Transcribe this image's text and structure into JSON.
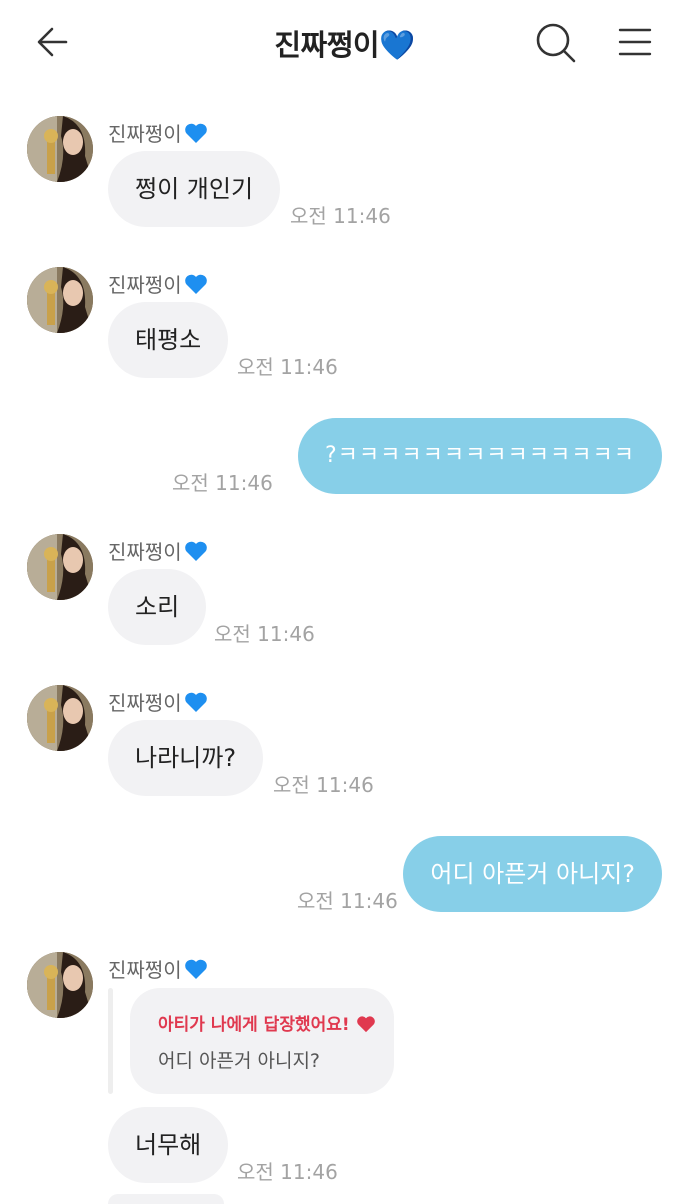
{
  "header": {
    "title": "진짜쩡이💙"
  },
  "messages": [
    {
      "sender": "진짜쩡이",
      "text": "쩡이 개인기",
      "time": "오전 11:46"
    },
    {
      "sender": "진짜쩡이",
      "text": "태평소",
      "time": "오전 11:46"
    },
    {
      "text": "?ㅋㅋㅋㅋㅋㅋㅋㅋㅋㅋㅋㅋㅋㅋ",
      "time": "오전 11:46"
    },
    {
      "sender": "진짜쩡이",
      "text": "소리",
      "time": "오전 11:46"
    },
    {
      "sender": "진짜쩡이",
      "text": "나라니까?",
      "time": "오전 11:46"
    },
    {
      "text": "어디 아픈거 아니지?",
      "time": "오전 11:46"
    },
    {
      "sender": "진짜쩡이",
      "reply_header": "아티가 나에게 답장했어요!",
      "reply_quote": "어디 아픈거 아니지?",
      "text": "너무해",
      "time": "오전 11:46"
    }
  ],
  "colors": {
    "outgoing_bubble": "#87cfe8",
    "incoming_bubble": "#f2f2f4",
    "reply_accent": "#e0394f",
    "heart": "#1e8ff0"
  }
}
